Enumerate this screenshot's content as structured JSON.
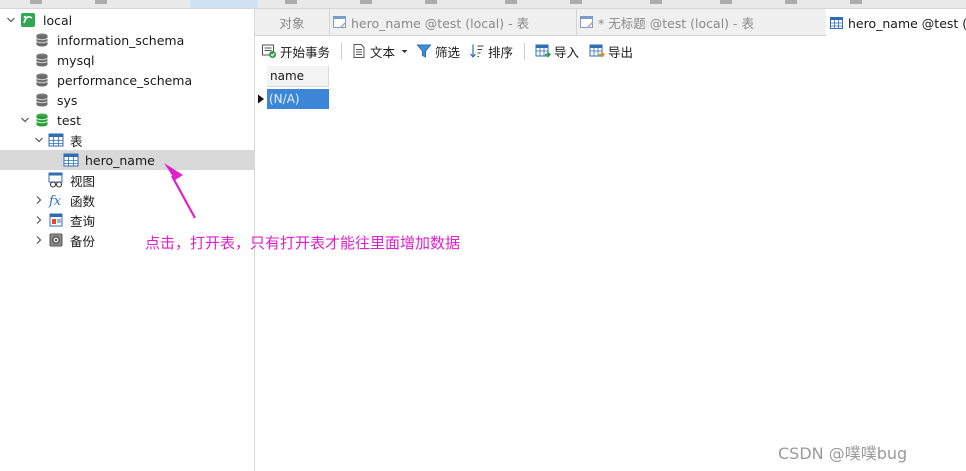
{
  "tree": {
    "connection": "local",
    "databases": [
      "information_schema",
      "mysql",
      "performance_schema",
      "sys",
      "test"
    ],
    "tables_group": "表",
    "selected_table": "hero_name",
    "views": "视图",
    "functions": "函数",
    "queries": "查询",
    "backups": "备份"
  },
  "tabs": [
    {
      "label": "对象"
    },
    {
      "label": "hero_name @test (local) - 表"
    },
    {
      "label": "* 无标题 @test (local) - 表"
    },
    {
      "label": "hero_name @test (local) - 表"
    }
  ],
  "toolbar": {
    "begin_transaction": "开始事务",
    "text": "文本",
    "filter": "筛选",
    "sort": "排序",
    "import": "导入",
    "export": "导出"
  },
  "grid": {
    "column": "name",
    "cell_value": "(N/A)"
  },
  "annotation": "点击，打开表，只有打开表才能往里面增加数据",
  "watermark": "CSDN @噗噗bug",
  "colors": {
    "annotation": "#e020cc",
    "selection_cell": "#3b86d6",
    "db_icon": "#6b6b6b",
    "db_icon_active": "#2e9c3a"
  }
}
